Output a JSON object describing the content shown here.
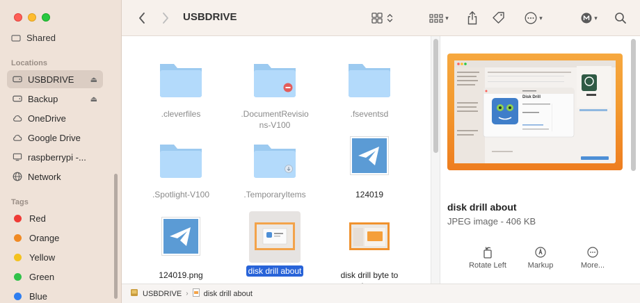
{
  "window": {
    "title": "USBDRIVE"
  },
  "sidebar": {
    "partial_item": "Shared",
    "sections": {
      "locations": "Locations",
      "tags": "Tags"
    },
    "locations": [
      {
        "label": "USBDRIVE",
        "icon": "drive-icon",
        "eject": true,
        "selected": true
      },
      {
        "label": "Backup",
        "icon": "drive-icon",
        "eject": true,
        "selected": false
      },
      {
        "label": "OneDrive",
        "icon": "cloud-icon",
        "eject": false,
        "selected": false
      },
      {
        "label": "Google Drive",
        "icon": "cloud-icon",
        "eject": false,
        "selected": false
      },
      {
        "label": "raspberrypi -...",
        "icon": "display-icon",
        "eject": false,
        "selected": false
      },
      {
        "label": "Network",
        "icon": "globe-icon",
        "eject": false,
        "selected": false
      }
    ],
    "tags": [
      {
        "label": "Red",
        "color": "#ef3b36"
      },
      {
        "label": "Orange",
        "color": "#f08a24"
      },
      {
        "label": "Yellow",
        "color": "#f4c21f"
      },
      {
        "label": "Green",
        "color": "#31c24a"
      },
      {
        "label": "Blue",
        "color": "#2f7ef0"
      }
    ]
  },
  "files": [
    {
      "name": ".cleverfiles",
      "type": "folder",
      "dim": true
    },
    {
      "name": ".DocumentRevisions-V100",
      "type": "folder",
      "dim": true,
      "badge": "no-entry"
    },
    {
      "name": ".fseventsd",
      "type": "folder",
      "dim": true
    },
    {
      "name": ".Spotlight-V100",
      "type": "folder",
      "dim": true
    },
    {
      "name": ".TemporaryItems",
      "type": "folder",
      "dim": true,
      "badge": "download"
    },
    {
      "name": "124019",
      "type": "telegram",
      "dim": false
    },
    {
      "name": "124019.png",
      "type": "telegram",
      "dim": false
    },
    {
      "name": "disk drill about",
      "type": "screenshot",
      "dim": false,
      "selected": true
    },
    {
      "name": "disk drill byte to byte",
      "type": "screenshot",
      "dim": false
    }
  ],
  "preview": {
    "title": "disk drill about",
    "subtitle": "JPEG image - 406 KB",
    "thumb_dialog_title": "Disk Drill",
    "actions": [
      {
        "label": "Rotate Left",
        "icon": "rotate-left-icon"
      },
      {
        "label": "Markup",
        "icon": "markup-icon"
      },
      {
        "label": "More...",
        "icon": "more-icon"
      }
    ]
  },
  "pathbar": {
    "root": "USBDRIVE",
    "current": "disk drill about"
  },
  "colors": {
    "sidebar_bg": "#efe2d8",
    "selection_blue": "#2863d8",
    "folder_blue": "#a9d1f5"
  }
}
